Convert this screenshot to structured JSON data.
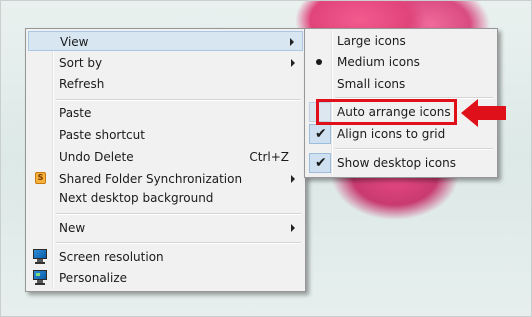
{
  "context_menu": {
    "items": [
      {
        "label": "View",
        "submenu": true
      },
      {
        "label": "Sort by",
        "submenu": true
      },
      {
        "label": "Refresh"
      },
      {
        "label": "Paste"
      },
      {
        "label": "Paste shortcut"
      },
      {
        "label": "Undo Delete",
        "shortcut": "Ctrl+Z"
      },
      {
        "label": "Shared Folder Synchronization",
        "submenu": true,
        "icon": "shared-folder-sync-icon"
      },
      {
        "label": "Next desktop background"
      },
      {
        "label": "New",
        "submenu": true
      },
      {
        "label": "Screen resolution",
        "icon": "monitor-icon"
      },
      {
        "label": "Personalize",
        "icon": "monitor-icon"
      }
    ]
  },
  "view_submenu": {
    "items": [
      {
        "label": "Large icons",
        "state": "none"
      },
      {
        "label": "Medium icons",
        "state": "selected-bullet"
      },
      {
        "label": "Small icons",
        "state": "none"
      },
      {
        "label": "Auto arrange icons",
        "state": "unchecked",
        "highlighted": true
      },
      {
        "label": "Align icons to grid",
        "state": "checked"
      },
      {
        "label": "Show desktop icons",
        "state": "checked"
      }
    ]
  },
  "annotation": {
    "highlight_color": "#e0101a",
    "arrow_icon": "red-arrow-left-icon"
  },
  "colors": {
    "menu_bg": "#f1f1f1",
    "hover_bg": "#d8e6f2",
    "accent_red": "#e0101a"
  }
}
